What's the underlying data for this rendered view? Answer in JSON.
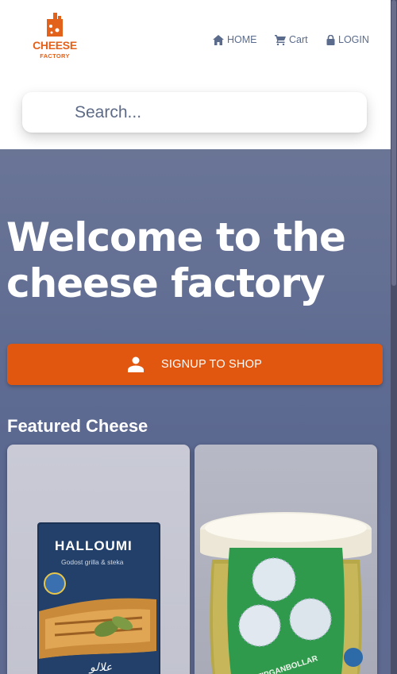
{
  "brand": {
    "name": "CHEESE",
    "sub": "FACTORY",
    "color": "#e2611b"
  },
  "nav": {
    "home": {
      "label": "HOME",
      "icon": "home-icon"
    },
    "cart": {
      "label": "Cart",
      "icon": "cart-icon"
    },
    "login": {
      "label": "LOGIN",
      "icon": "lock-icon"
    }
  },
  "search": {
    "placeholder": "Search..."
  },
  "hero": {
    "title": "Welcome to the cheese factory",
    "signup": {
      "label": "SIGNUP TO SHOP",
      "icon": "person-icon",
      "color": "#e2570f"
    }
  },
  "featured": {
    "title": "Featured Cheese",
    "cards": [
      {
        "product_label": "HALLOUMI",
        "product_sub": "Godost grilla & steka"
      },
      {
        "product_label": "TIPGANBOLLAR"
      }
    ]
  }
}
